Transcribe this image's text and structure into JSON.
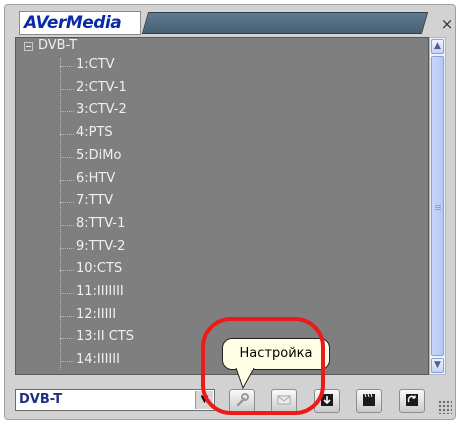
{
  "app": {
    "logo_text": "AVerMedia",
    "close_glyph": "×"
  },
  "tree": {
    "root_label": "DVB-T",
    "channels": [
      "1:CTV",
      "2:CTV-1",
      "3:CTV-2",
      "4:PTS",
      "5:DiMo",
      "6:HTV",
      "7:TTV",
      "8:TTV-1",
      "9:TTV-2",
      "10:CTS",
      "11:IIIIIII",
      "12:IIIII",
      "13:II CTS",
      "14:IIIIII"
    ]
  },
  "bottom": {
    "combo_value": "DVB-T",
    "combo_arrow": "▼",
    "buttons": [
      {
        "name": "settings-button",
        "icon": "wrench-icon",
        "disabled": true
      },
      {
        "name": "message-button",
        "icon": "envelope-icon",
        "disabled": true
      },
      {
        "name": "import-button",
        "icon": "download-icon",
        "disabled": false
      },
      {
        "name": "record-button",
        "icon": "clapperboard-icon",
        "disabled": false
      },
      {
        "name": "refresh-button",
        "icon": "refresh-icon",
        "disabled": false
      }
    ]
  },
  "tooltip": {
    "text": "Настройка"
  },
  "colors": {
    "annotation": "#ee1a1a",
    "tree_bg": "#7f7f7f",
    "scrollbar_accent": "#8aa0d8"
  }
}
